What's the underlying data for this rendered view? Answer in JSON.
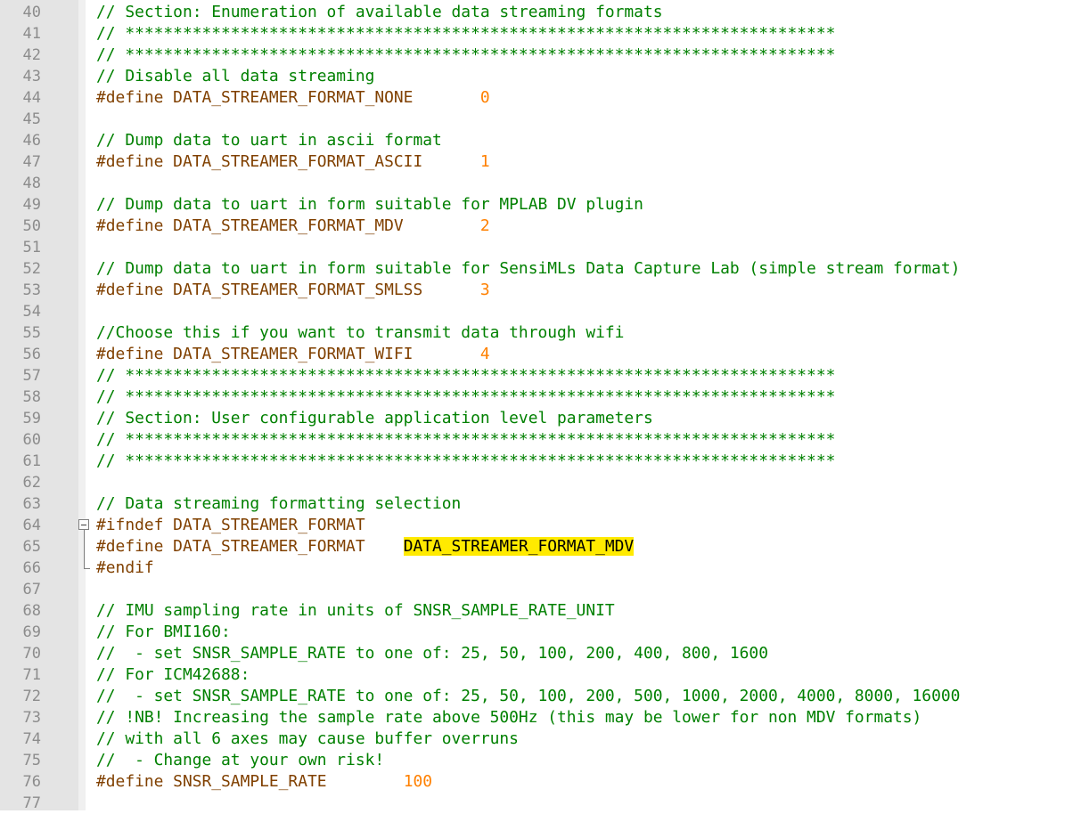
{
  "editor": {
    "lines": [
      {
        "n": "40",
        "segs": [
          {
            "t": "// Section: Enumeration of available data streaming formats",
            "c": "comment"
          }
        ]
      },
      {
        "n": "41",
        "segs": [
          {
            "t": "// **************************************************************************",
            "c": "comment"
          }
        ]
      },
      {
        "n": "42",
        "segs": [
          {
            "t": "// **************************************************************************",
            "c": "comment"
          }
        ]
      },
      {
        "n": "43",
        "segs": [
          {
            "t": "// Disable all data streaming",
            "c": "comment"
          }
        ]
      },
      {
        "n": "44",
        "segs": [
          {
            "t": "#define DATA_STREAMER_FORMAT_NONE       ",
            "c": "pre"
          },
          {
            "t": "0",
            "c": "num"
          }
        ]
      },
      {
        "n": "45",
        "segs": []
      },
      {
        "n": "46",
        "segs": [
          {
            "t": "// Dump data to uart in ascii format",
            "c": "comment"
          }
        ]
      },
      {
        "n": "47",
        "segs": [
          {
            "t": "#define DATA_STREAMER_FORMAT_ASCII      ",
            "c": "pre"
          },
          {
            "t": "1",
            "c": "num"
          }
        ]
      },
      {
        "n": "48",
        "segs": []
      },
      {
        "n": "49",
        "segs": [
          {
            "t": "// Dump data to uart in form suitable for MPLAB DV plugin",
            "c": "comment"
          }
        ]
      },
      {
        "n": "50",
        "segs": [
          {
            "t": "#define DATA_STREAMER_FORMAT_MDV        ",
            "c": "pre"
          },
          {
            "t": "2",
            "c": "num"
          }
        ]
      },
      {
        "n": "51",
        "segs": []
      },
      {
        "n": "52",
        "segs": [
          {
            "t": "// Dump data to uart in form suitable for SensiMLs Data Capture Lab (simple stream format)",
            "c": "comment"
          }
        ]
      },
      {
        "n": "53",
        "segs": [
          {
            "t": "#define DATA_STREAMER_FORMAT_SMLSS      ",
            "c": "pre"
          },
          {
            "t": "3",
            "c": "num"
          }
        ]
      },
      {
        "n": "54",
        "segs": []
      },
      {
        "n": "55",
        "segs": [
          {
            "t": "//Choose this if you want to transmit data through wifi",
            "c": "comment"
          }
        ]
      },
      {
        "n": "56",
        "segs": [
          {
            "t": "#define DATA_STREAMER_FORMAT_WIFI       ",
            "c": "pre"
          },
          {
            "t": "4",
            "c": "num"
          }
        ]
      },
      {
        "n": "57",
        "segs": [
          {
            "t": "// **************************************************************************",
            "c": "comment"
          }
        ]
      },
      {
        "n": "58",
        "segs": [
          {
            "t": "// **************************************************************************",
            "c": "comment"
          }
        ]
      },
      {
        "n": "59",
        "segs": [
          {
            "t": "// Section: User configurable application level parameters",
            "c": "comment"
          }
        ]
      },
      {
        "n": "60",
        "segs": [
          {
            "t": "// **************************************************************************",
            "c": "comment"
          }
        ]
      },
      {
        "n": "61",
        "segs": [
          {
            "t": "// **************************************************************************",
            "c": "comment"
          }
        ]
      },
      {
        "n": "62",
        "segs": []
      },
      {
        "n": "63",
        "segs": [
          {
            "t": "// Data streaming formatting selection",
            "c": "comment"
          }
        ]
      },
      {
        "n": "64",
        "segs": [
          {
            "t": "#ifndef DATA_STREAMER_FORMAT",
            "c": "pre"
          }
        ],
        "fold": "start"
      },
      {
        "n": "65",
        "segs": [
          {
            "t": "#define DATA_STREAMER_FORMAT    ",
            "c": "pre"
          },
          {
            "t": "DATA_STREAMER_FORMAT_MDV",
            "c": "hl"
          }
        ]
      },
      {
        "n": "66",
        "segs": [
          {
            "t": "#endif",
            "c": "pre"
          }
        ],
        "fold": "end"
      },
      {
        "n": "67",
        "segs": []
      },
      {
        "n": "68",
        "segs": [
          {
            "t": "// IMU sampling rate in units of SNSR_SAMPLE_RATE_UNIT",
            "c": "comment"
          }
        ]
      },
      {
        "n": "69",
        "segs": [
          {
            "t": "// For BMI160:",
            "c": "comment"
          }
        ]
      },
      {
        "n": "70",
        "segs": [
          {
            "t": "//  - set SNSR_SAMPLE_RATE to one of: 25, 50, 100, 200, 400, 800, 1600",
            "c": "comment"
          }
        ]
      },
      {
        "n": "71",
        "segs": [
          {
            "t": "// For ICM42688:",
            "c": "comment"
          }
        ]
      },
      {
        "n": "72",
        "segs": [
          {
            "t": "//  - set SNSR_SAMPLE_RATE to one of: 25, 50, 100, 200, 500, 1000, 2000, 4000, 8000, 16000",
            "c": "comment"
          }
        ]
      },
      {
        "n": "73",
        "segs": [
          {
            "t": "// !NB! Increasing the sample rate above 500Hz (this may be lower for non MDV formats)",
            "c": "comment"
          }
        ]
      },
      {
        "n": "74",
        "segs": [
          {
            "t": "// with all 6 axes may cause buffer overruns",
            "c": "comment"
          }
        ]
      },
      {
        "n": "75",
        "segs": [
          {
            "t": "//  - Change at your own risk!",
            "c": "comment"
          }
        ]
      },
      {
        "n": "76",
        "segs": [
          {
            "t": "#define SNSR_SAMPLE_RATE        ",
            "c": "pre"
          },
          {
            "t": "100",
            "c": "num"
          }
        ]
      },
      {
        "n": "77",
        "segs": []
      }
    ]
  },
  "colors": {
    "comment": "#008000",
    "preprocessor": "#804000",
    "number": "#ff8000",
    "highlight": "#ffea00",
    "gutter": "#e4e4e4",
    "line_number": "#8c8c8c"
  },
  "icons": {
    "fold_start": "fold-collapse-minus-icon",
    "fold_end": "fold-end-icon"
  }
}
